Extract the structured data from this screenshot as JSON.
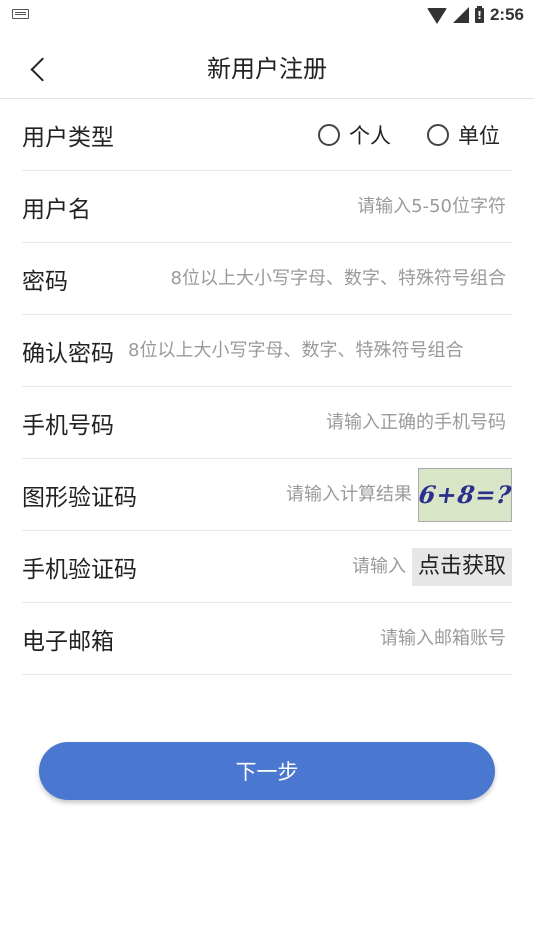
{
  "status_bar": {
    "time": "2:56"
  },
  "header": {
    "title": "新用户注册"
  },
  "form": {
    "user_type": {
      "label": "用户类型",
      "options": [
        "个人",
        "单位"
      ]
    },
    "username": {
      "label": "用户名",
      "placeholder": "请输入5-50位字符"
    },
    "password": {
      "label": "密码",
      "placeholder": "8位以上大小写字母、数字、特殊符号组合"
    },
    "confirm_password": {
      "label": "确认密码",
      "placeholder": "8位以上大小写字母、数字、特殊符号组合"
    },
    "phone": {
      "label": "手机号码",
      "placeholder": "请输入正确的手机号码"
    },
    "captcha": {
      "label": "图形验证码",
      "placeholder": "请输入计算结果",
      "image_text": "6+8=?"
    },
    "sms_code": {
      "label": "手机验证码",
      "placeholder": "请输入",
      "button": "点击获取"
    },
    "email": {
      "label": "电子邮箱",
      "placeholder": "请输入邮箱账号"
    }
  },
  "next_button": "下一步"
}
